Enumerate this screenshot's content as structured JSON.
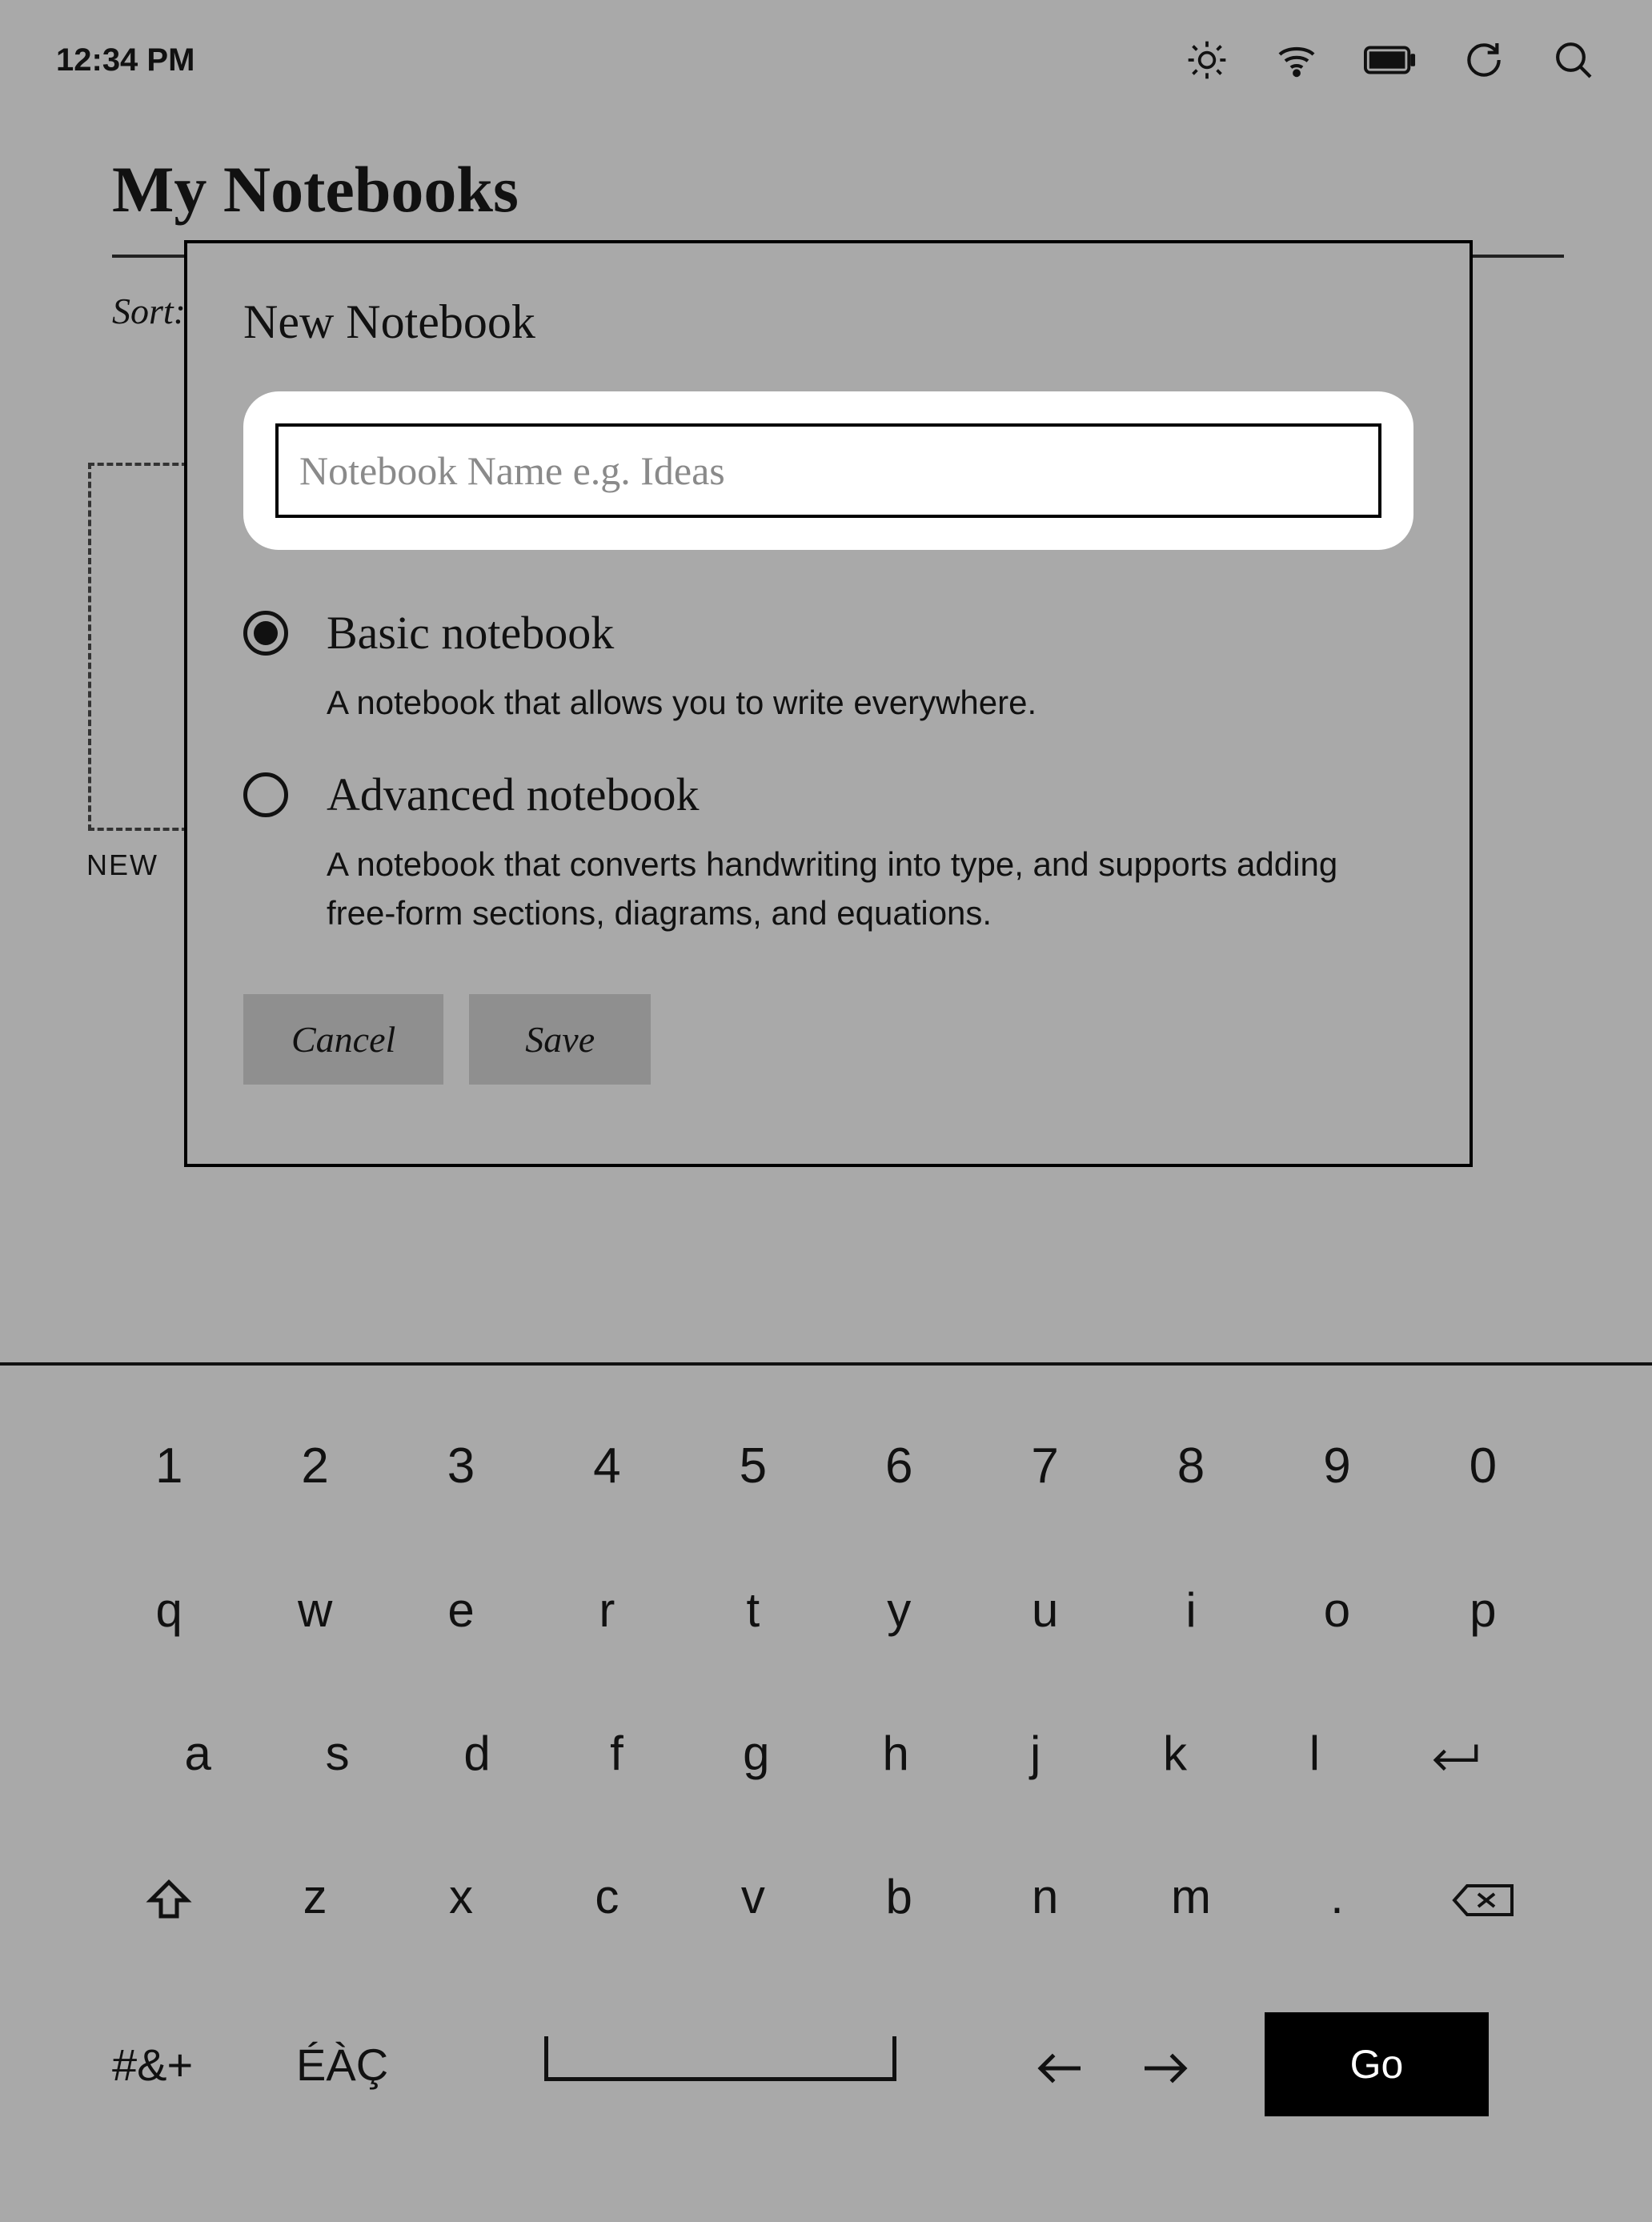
{
  "status": {
    "time": "12:34 PM"
  },
  "page": {
    "title": "My Notebooks",
    "sort_label": "Sort:",
    "new_tile_label": "NEW"
  },
  "modal": {
    "title": "New Notebook",
    "name_placeholder": "Notebook Name e.g. Ideas",
    "name_value": "",
    "options": [
      {
        "title": "Basic notebook",
        "desc": "A notebook that allows you to write everywhere.",
        "selected": true
      },
      {
        "title": "Advanced notebook",
        "desc": "A notebook that converts handwriting into type, and supports adding free-form sections, diagrams, and equations.",
        "selected": false
      }
    ],
    "cancel_label": "Cancel",
    "save_label": "Save"
  },
  "keyboard": {
    "row1": [
      "1",
      "2",
      "3",
      "4",
      "5",
      "6",
      "7",
      "8",
      "9",
      "0"
    ],
    "row2": [
      "q",
      "w",
      "e",
      "r",
      "t",
      "y",
      "u",
      "i",
      "o",
      "p"
    ],
    "row3": [
      "a",
      "s",
      "d",
      "f",
      "g",
      "h",
      "j",
      "k",
      "l"
    ],
    "row4_letters": [
      "z",
      "x",
      "c",
      "v",
      "b",
      "n",
      "m",
      "."
    ],
    "symbols_label": "#&+",
    "accent_label": "ÉÀÇ",
    "go_label": "Go"
  }
}
